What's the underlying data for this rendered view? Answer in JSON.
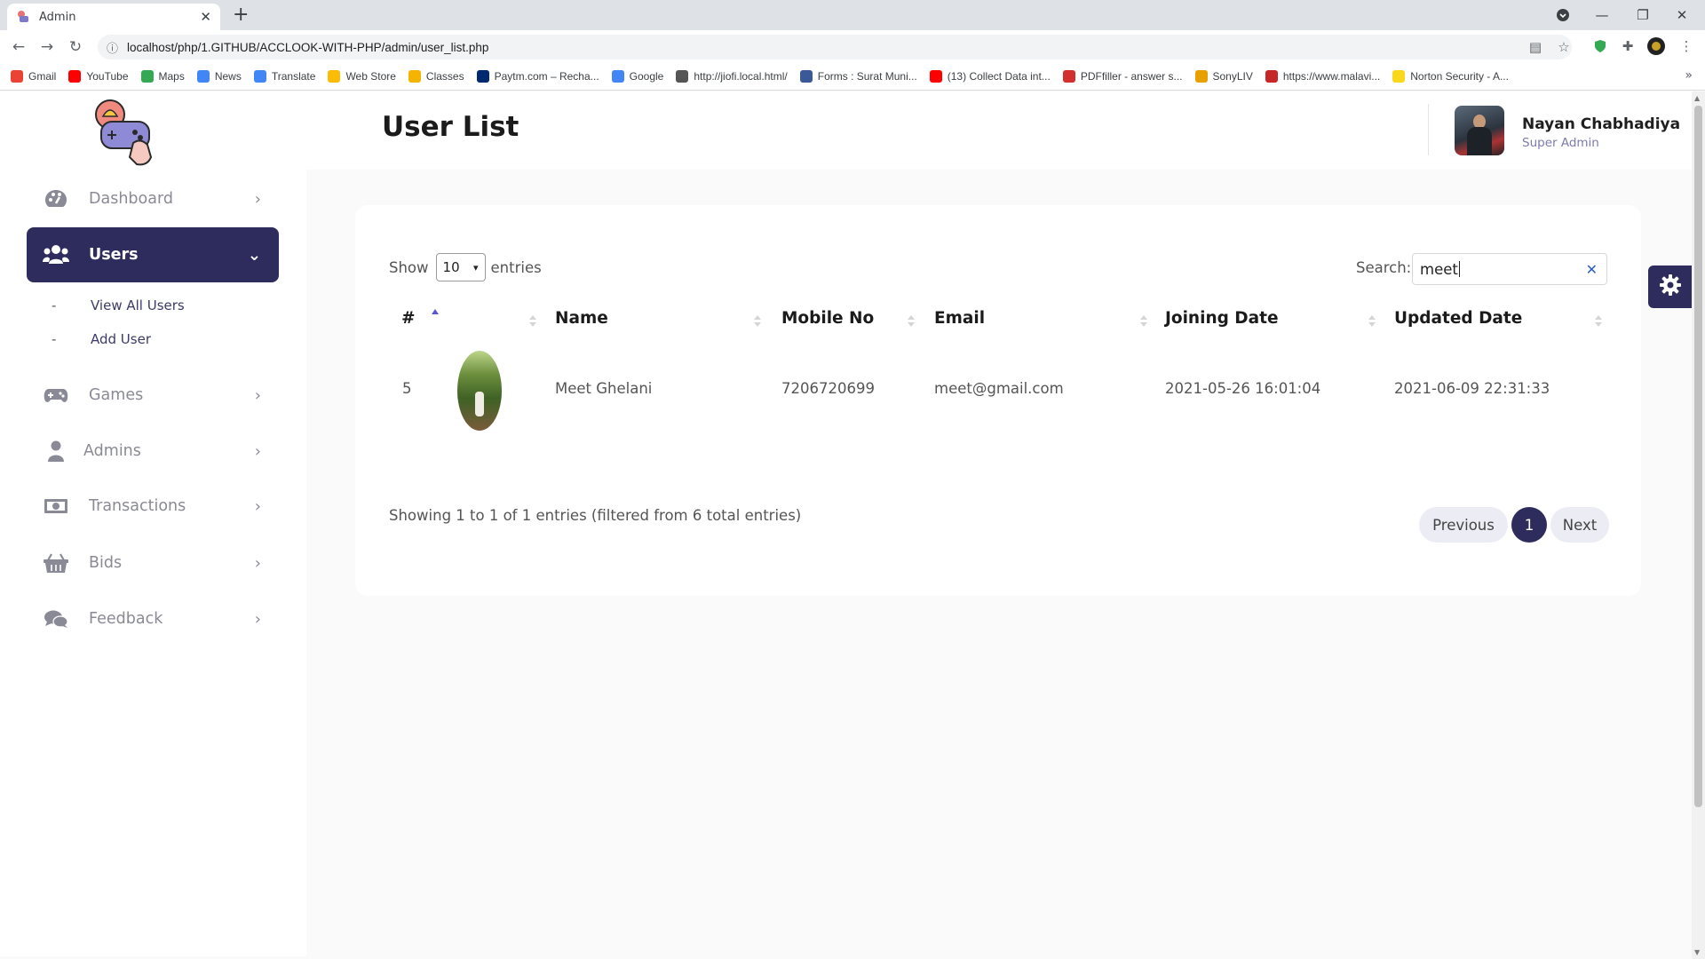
{
  "browser": {
    "tab_title": "Admin",
    "url": "localhost/php/1.GITHUB/ACCLOOK-WITH-PHP/admin/user_list.php",
    "bookmarks": [
      {
        "label": "Gmail",
        "color": "#ea4335"
      },
      {
        "label": "YouTube",
        "color": "#ff0000"
      },
      {
        "label": "Maps",
        "color": "#34a853"
      },
      {
        "label": "News",
        "color": "#4285f4"
      },
      {
        "label": "Translate",
        "color": "#4285f4"
      },
      {
        "label": "Web Store",
        "color": "#fbbc05"
      },
      {
        "label": "Classes",
        "color": "#f4b400"
      },
      {
        "label": "Paytm.com – Recha...",
        "color": "#002970"
      },
      {
        "label": "Google",
        "color": "#4285f4"
      },
      {
        "label": "http://jiofi.local.html/",
        "color": "#555555"
      },
      {
        "label": "Forms : Surat Muni...",
        "color": "#3b5998"
      },
      {
        "label": "(13) Collect Data int...",
        "color": "#ff0000"
      },
      {
        "label": "PDFfiller - answer s...",
        "color": "#d32f2f"
      },
      {
        "label": "SonyLIV",
        "color": "#e6a100"
      },
      {
        "label": "https://www.malavi...",
        "color": "#c62828"
      },
      {
        "label": "Norton Security - A...",
        "color": "#f9d71c"
      }
    ]
  },
  "sidebar": {
    "items": [
      {
        "label": "Dashboard",
        "icon": "palette-icon"
      },
      {
        "label": "Users",
        "icon": "users-icon",
        "active": true
      },
      {
        "label": "Games",
        "icon": "gamepad-icon"
      },
      {
        "label": "Admins",
        "icon": "user-icon"
      },
      {
        "label": "Transactions",
        "icon": "money-icon"
      },
      {
        "label": "Bids",
        "icon": "basket-icon"
      },
      {
        "label": "Feedback",
        "icon": "comments-icon"
      }
    ],
    "subitems": [
      "View All Users",
      "Add User"
    ],
    "sub_dash": "-"
  },
  "header": {
    "title": "User List",
    "user_name": "Nayan Chabhadiya",
    "user_role": "Super Admin"
  },
  "table": {
    "show_label": "Show",
    "entries_value": "10",
    "entries_label": "entries",
    "search_label": "Search:",
    "search_value": "meet",
    "columns": [
      "#",
      "",
      "Name",
      "Mobile No",
      "Email",
      "Joining Date",
      "Updated Date"
    ],
    "rows": [
      {
        "id": "5",
        "name": "Meet Ghelani",
        "mobile": "7206720699",
        "email": "meet@gmail.com",
        "joined": "2021-05-26 16:01:04",
        "updated": "2021-06-09 22:31:33"
      }
    ],
    "info": "Showing 1 to 1 of 1 entries (filtered from 6 total entries)",
    "pagination": {
      "previous": "Previous",
      "current": "1",
      "next": "Next"
    }
  },
  "colors": {
    "accent": "#2e2c5c",
    "background": "#fafafa"
  }
}
